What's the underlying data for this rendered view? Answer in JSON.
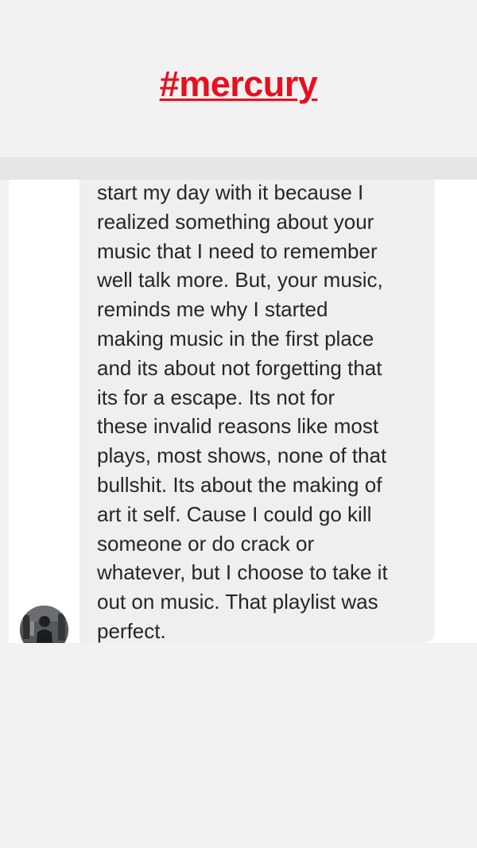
{
  "story": {
    "hashtag": "#mercury"
  },
  "message": {
    "text": "start my day with it because I\nrealized something about your\nmusic that I need to remember\nwell talk more. But, your music,\nreminds me why I started\nmaking music in the first place\nand its about not forgetting that\nits for a escape. Its not for\nthese invalid reasons like most\nplays, most shows, none of that\nbullshit. Its about the making of\nart it self. Cause I could go kill\nsomeone or do crack or\nwhatever, but I choose to take it\nout on music. That playlist was\nperfect."
  },
  "sender": {
    "avatar": "sender-avatar-photo"
  },
  "colors": {
    "hashtag": "#e8101f",
    "page_background": "#f2f2f2",
    "bubble": "#efefef",
    "text": "#262626"
  }
}
